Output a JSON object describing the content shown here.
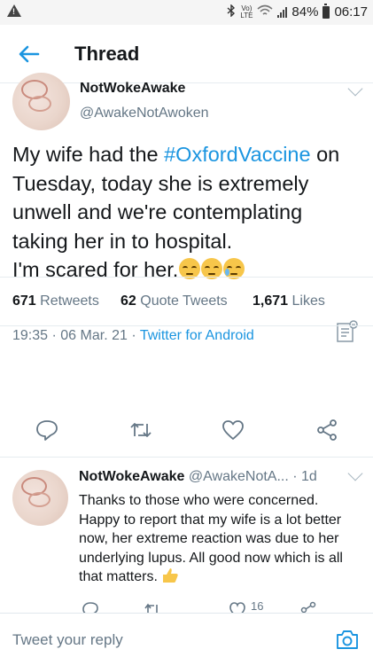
{
  "status_bar": {
    "battery": "84%",
    "time": "06:17",
    "network": "LTE",
    "icons": [
      "warning-icon",
      "bluetooth-icon",
      "volte-icon",
      "wifi-icon",
      "signal-icon",
      "battery-icon"
    ]
  },
  "header": {
    "title": "Thread",
    "back_icon": "arrow-left-icon"
  },
  "main_tweet": {
    "name": "NotWokeAwake",
    "handle": "@AwakeNotAwoken",
    "text_before": "My wife had the ",
    "hashtag": "#OxfordVaccine",
    "text_after": " on Tuesday, today she is extremely unwell and we're contemplating taking her in to hospital.",
    "text_line2": "I'm scared for her.",
    "emojis": [
      "pensive-face-emoji",
      "pensive-face-emoji",
      "sad-but-relieved-face-emoji"
    ],
    "time": "19:35",
    "date": "06 Mar. 21",
    "source": "Twitter for Android",
    "separator": "·"
  },
  "stats": {
    "retweets_count": "671",
    "retweets_label": "Retweets",
    "quotes_count": "62",
    "quotes_label": "Quote Tweets",
    "likes_count": "1,671",
    "likes_label": "Likes"
  },
  "reply_tweet": {
    "name": "NotWokeAwake",
    "handle": "@AwakeNotA...",
    "age": "1d",
    "separator": "·",
    "text": "Thanks to those who were concerned. Happy to report that my wife is a lot better now, her extreme reaction was due to her underlying lupus. All good now which is all that matters.",
    "emoji": "thumbs-up-emoji",
    "like_count": "16"
  },
  "compose": {
    "placeholder": "Tweet your reply",
    "camera_icon": "camera-icon"
  },
  "colors": {
    "accent": "#1b95e0",
    "secondary_text": "#657786",
    "divider": "#e6ecf0"
  }
}
